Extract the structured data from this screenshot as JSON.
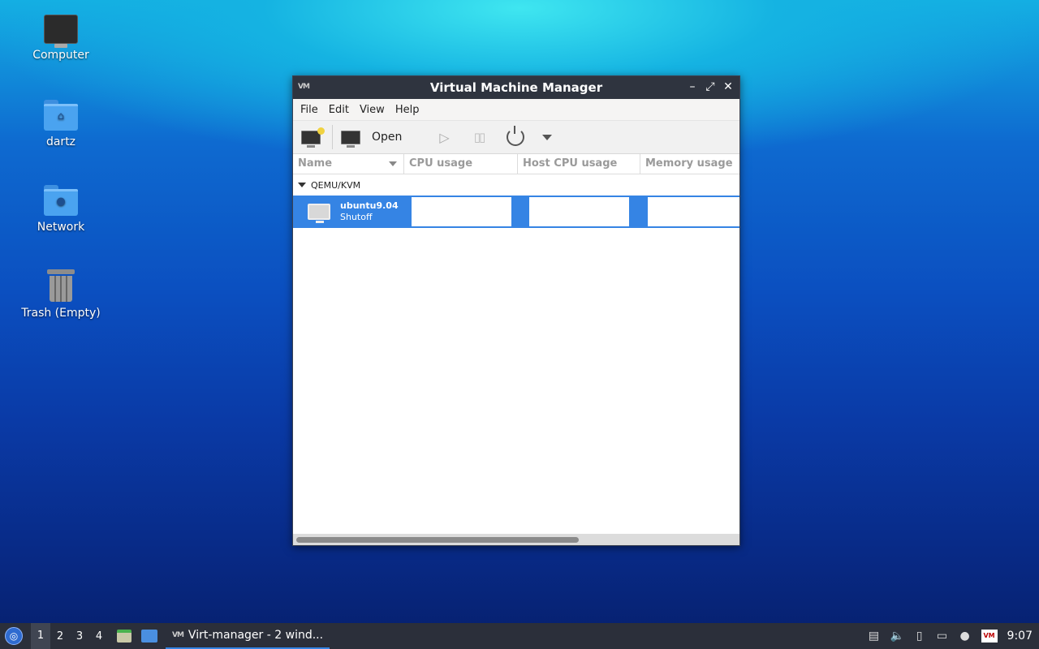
{
  "desktop": {
    "icons": [
      {
        "label": "Computer",
        "icon": "computer-icon"
      },
      {
        "label": "dartz",
        "icon": "home-folder-icon"
      },
      {
        "label": "Network",
        "icon": "network-folder-icon"
      },
      {
        "label": "Trash (Empty)",
        "icon": "trash-icon"
      }
    ]
  },
  "window": {
    "title": "Virtual Machine Manager",
    "app_icon_text": "VM",
    "menu": [
      "File",
      "Edit",
      "View",
      "Help"
    ],
    "toolbar": {
      "open_label": "Open"
    },
    "columns": [
      "Name",
      "CPU usage",
      "Host CPU usage",
      "Memory usage"
    ],
    "group": "QEMU/KVM",
    "vms": [
      {
        "name": "ubuntu9.04",
        "status": "Shutoff"
      }
    ]
  },
  "taskbar": {
    "workspaces": [
      "1",
      "2",
      "3",
      "4"
    ],
    "active_workspace": "1",
    "task_label": "Virt-manager - 2 wind...",
    "clock": "9:07",
    "tray_vm_text": "VM"
  },
  "colors": {
    "accent": "#3584e4",
    "titlebar": "#2f343f",
    "taskbar": "#2b2f3a"
  }
}
